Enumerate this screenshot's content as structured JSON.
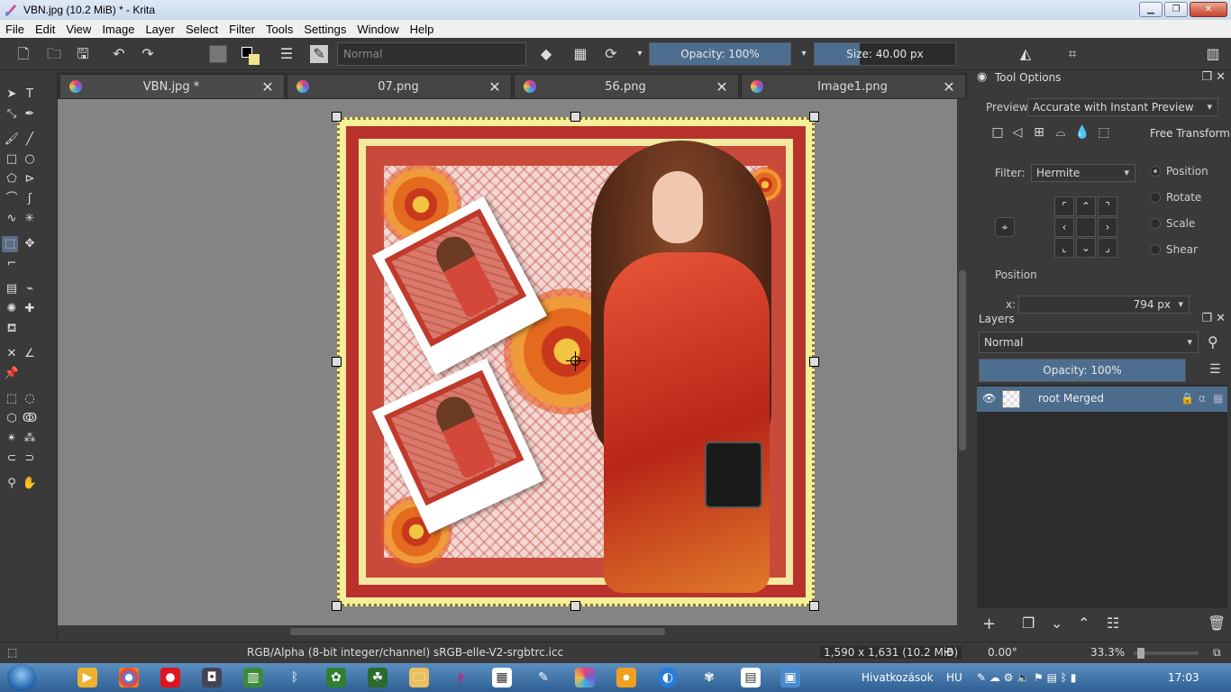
{
  "window": {
    "title": "VBN.jpg (10.2 MiB)  * - Krita",
    "minimize_glyph": "▁",
    "restore_glyph": "❐",
    "close_glyph": "✕"
  },
  "menu": [
    "File",
    "Edit",
    "View",
    "Image",
    "Layer",
    "Select",
    "Filter",
    "Tools",
    "Settings",
    "Window",
    "Help"
  ],
  "toolbar": {
    "blend_mode": "Normal",
    "opacity_label": "Opacity: 100%",
    "opacity_value": 1.0,
    "size_label": "Size: 40.00 px",
    "size_value": 40
  },
  "tabs": [
    {
      "label": "VBN.jpg *",
      "close": "✕"
    },
    {
      "label": "07.png",
      "close": "✕"
    },
    {
      "label": "56.png",
      "close": "✕"
    },
    {
      "label": "Image1.png",
      "close": "✕"
    }
  ],
  "tool_options": {
    "title": "Tool Options",
    "preview_label": "Preview",
    "preview_value": "Accurate with Instant Preview",
    "free_transform": "Free Transform",
    "filter_label": "Filter:",
    "filter_value": "Hermite",
    "modes": [
      "Position",
      "Rotate",
      "Scale",
      "Shear"
    ],
    "selected_mode": "Position",
    "position_label": "Position",
    "x_label": "x:",
    "x_value": "794 px"
  },
  "layers": {
    "title": "Layers",
    "blend_mode": "Normal",
    "opacity_label": "Opacity:  100%",
    "items": [
      {
        "name": "root Merged"
      }
    ]
  },
  "status": {
    "color_space": "RGB/Alpha (8-bit integer/channel)  sRGB-elle-V2-srgbtrc.icc",
    "dimensions": "1,590 x 1,631 (10.2 MiB)",
    "rotation": "0.00°",
    "zoom": "33.3%"
  },
  "taskbar": {
    "links_label": "Hivatkozások",
    "lang": "HU",
    "time": "17:03"
  }
}
